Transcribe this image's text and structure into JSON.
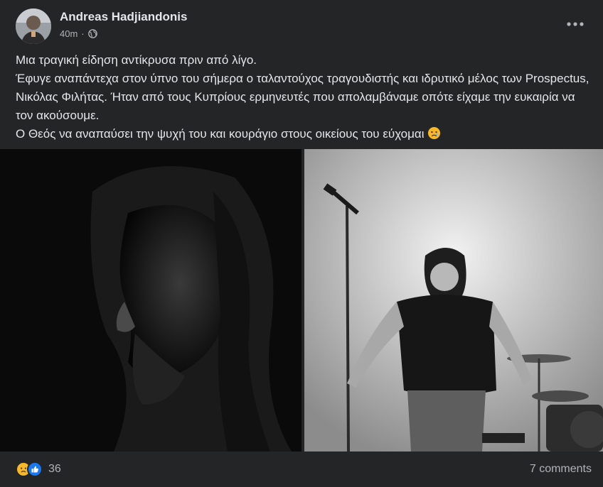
{
  "post": {
    "author": "Andreas Hadjiandonis",
    "time": "40m",
    "separator": "·",
    "privacy_icon": "globe-icon",
    "text_lines": [
      "Μια τραγική είδηση αντίκρυσα πριν από λίγο.",
      "Έφυγε αναπάντεχα στον ύπνο του σήμερα ο ταλαντούχος τραγουδιστής και ιδρυτικό μέλος των Prospectus, Νικόλας Φιλήτας. Ήταν από τους Κυπρίους ερμηνευτές που απολαμβάναμε οπότε είχαμε την ευκαιρία να τον ακούσουμε.",
      "Ο Θεός να αναπαύσει την ψυχή του και κουράγιο στους οικείους του εύχομαι"
    ],
    "emoji": "sad-emoji"
  },
  "photos": [
    {
      "icon": "portrait-photo",
      "tone": "black-and-white"
    },
    {
      "icon": "concert-photo",
      "tone": "black-and-white"
    }
  ],
  "footer": {
    "reaction_icons": [
      "sad-reaction-icon",
      "like-reaction-icon"
    ],
    "reaction_count": "36",
    "comments": "7 comments"
  },
  "colors": {
    "background": "#242526",
    "primary_text": "#e4e6eb",
    "secondary_text": "#b0b3b8",
    "like_blue": "#1877f2",
    "sad_yellow": "#f7b928"
  }
}
